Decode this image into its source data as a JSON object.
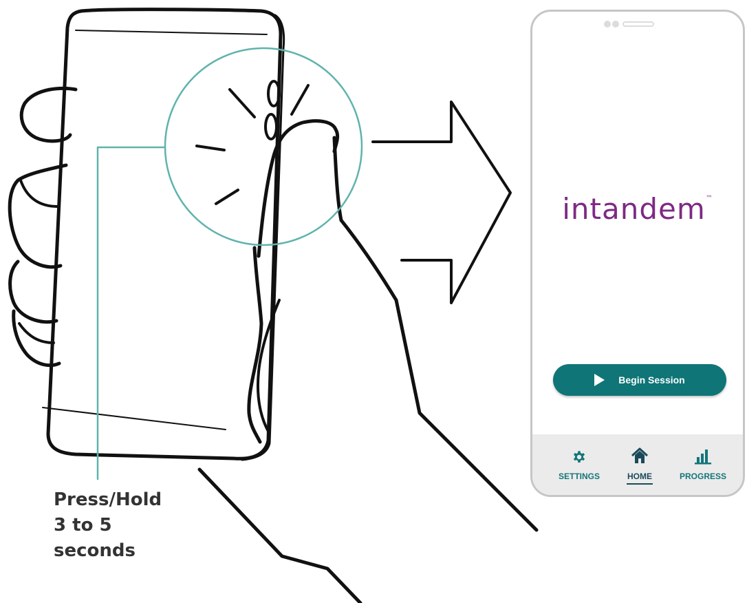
{
  "instruction": {
    "lines": [
      "Press/Hold",
      "3 to 5",
      "seconds"
    ]
  },
  "app_screen": {
    "logo_text": "intandem",
    "logo_trademark": "™",
    "begin_button_label": "Begin Session",
    "tabs": [
      {
        "label": "SETTINGS",
        "icon": "gear-icon",
        "active": false
      },
      {
        "label": "HOME",
        "icon": "home-icon",
        "active": true
      },
      {
        "label": "PROGRESS",
        "icon": "bar-chart-icon",
        "active": false
      }
    ]
  },
  "colors": {
    "line": "#111111",
    "callout": "#5fb3ad",
    "brand_teal": "#0f7577",
    "logo_purple": "#7d2a83",
    "caption_text": "#333333",
    "tab_bar_bg": "#ebebeb"
  }
}
